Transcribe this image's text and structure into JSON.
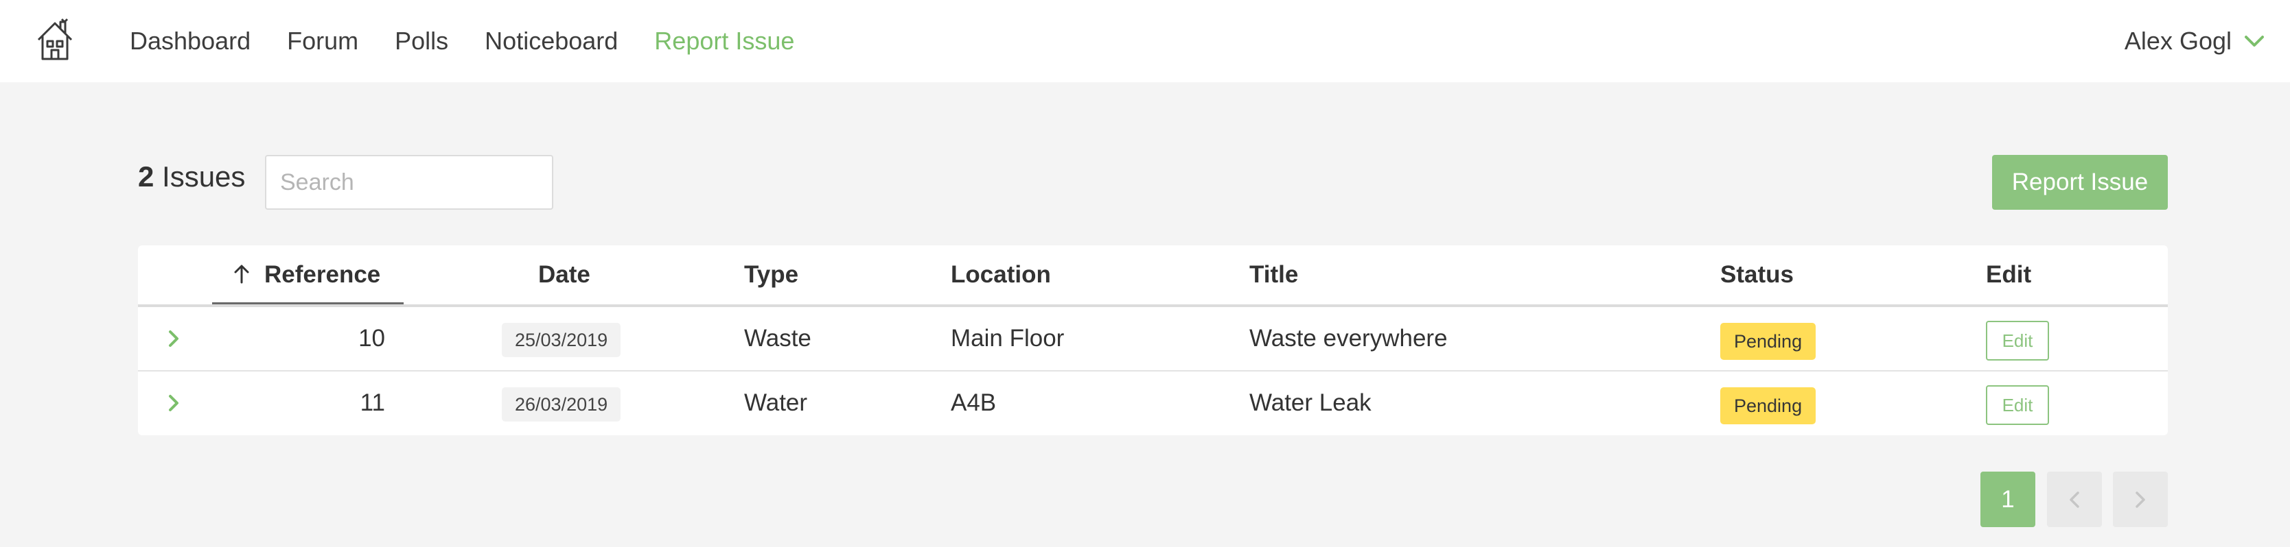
{
  "nav": {
    "logo_icon": "house-logo-icon",
    "links": [
      {
        "label": "Dashboard",
        "active": false
      },
      {
        "label": "Forum",
        "active": false
      },
      {
        "label": "Polls",
        "active": false
      },
      {
        "label": "Noticeboard",
        "active": false
      },
      {
        "label": "Report Issue",
        "active": true
      }
    ],
    "user": {
      "name": "Alex Gogl",
      "chevron_icon": "chevron-down-icon"
    }
  },
  "toolbar": {
    "issues_count": "2",
    "issues_label": "Issues",
    "search_placeholder": "Search",
    "search_value": "",
    "report_button": "Report Issue"
  },
  "table": {
    "headers": {
      "reference": "Reference",
      "date": "Date",
      "type": "Type",
      "location": "Location",
      "title": "Title",
      "status": "Status",
      "edit": "Edit"
    },
    "sort": {
      "column": "Reference",
      "direction": "ascending",
      "icon": "arrow-up-icon"
    },
    "rows": [
      {
        "reference": "10",
        "date": "25/03/2019",
        "type": "Waste",
        "location": "Main Floor",
        "title": "Waste everywhere",
        "status": "Pending",
        "edit": "Edit"
      },
      {
        "reference": "11",
        "date": "26/03/2019",
        "type": "Water",
        "location": "A4B",
        "title": "Water Leak",
        "status": "Pending",
        "edit": "Edit"
      }
    ]
  },
  "pagination": {
    "current_page": "1",
    "prev_icon": "chevron-left-icon",
    "next_icon": "chevron-right-icon"
  },
  "colors": {
    "accent": "#8cc47f",
    "accent_text": "#7cbf6b",
    "status_pending": "#ffdd57",
    "background": "#f4f4f4"
  }
}
